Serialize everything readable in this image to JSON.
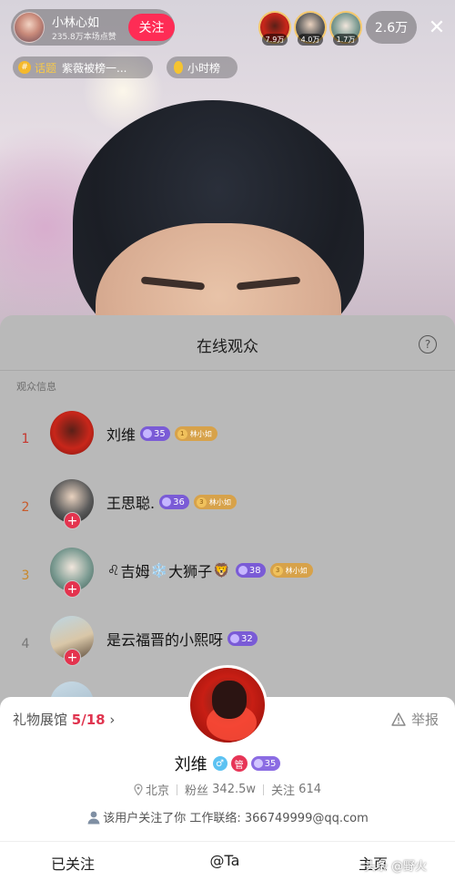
{
  "anchor": {
    "name": "小林心如",
    "likes": "235.8万本场点赞",
    "follow_label": "关注"
  },
  "top_viewers": [
    {
      "count": "7.9万"
    },
    {
      "count": "4.0万"
    },
    {
      "count": "1.7万"
    }
  ],
  "viewer_count": "2.6万",
  "close_icon": "close-icon",
  "topic": {
    "tag": "话题",
    "text": "紫薇被榜一..."
  },
  "hourly_rank": {
    "label": "小时榜"
  },
  "sheet": {
    "title": "在线观众",
    "section_label": "观众信息",
    "help_icon": "help-icon"
  },
  "viewers": [
    {
      "rank": "1",
      "name": "刘维",
      "level": "35",
      "fan_level": "1",
      "fan_club": "林小如",
      "rank_color": "#c7352c"
    },
    {
      "rank": "2",
      "name": "王思聪.",
      "level": "36",
      "fan_level": "3",
      "fan_club": "林小如",
      "rank_color": "#c95a2a"
    },
    {
      "rank": "3",
      "name_prefix": "♌",
      "name": "吉姆",
      "name_mid": "❄️",
      "name_suffix": "大狮子",
      "name_emoji": "🦁",
      "level": "38",
      "fan_level": "3",
      "fan_club": "林小如",
      "rank_color": "#c9882a"
    },
    {
      "rank": "4",
      "name": "是云福晋的小熙呀",
      "level": "32",
      "rank_color": "#777777"
    }
  ],
  "profile": {
    "gift_hall_label": "礼物展馆",
    "gift_hall_count": "5/18",
    "gift_hall_chevron": "›",
    "report_label": "举报",
    "name": "刘维",
    "gender_icon": "♂",
    "manager_badge": "管",
    "level": "35",
    "location": "北京",
    "fans_label": "粉丝",
    "fans_value": "342.5w",
    "following_label": "关注",
    "following_value": "614",
    "bio": "该用户关注了你 工作联络: 366749999@qq.com",
    "actions": [
      "已关注",
      "@Ta",
      "主页"
    ]
  },
  "watermark": "头条 @野火"
}
